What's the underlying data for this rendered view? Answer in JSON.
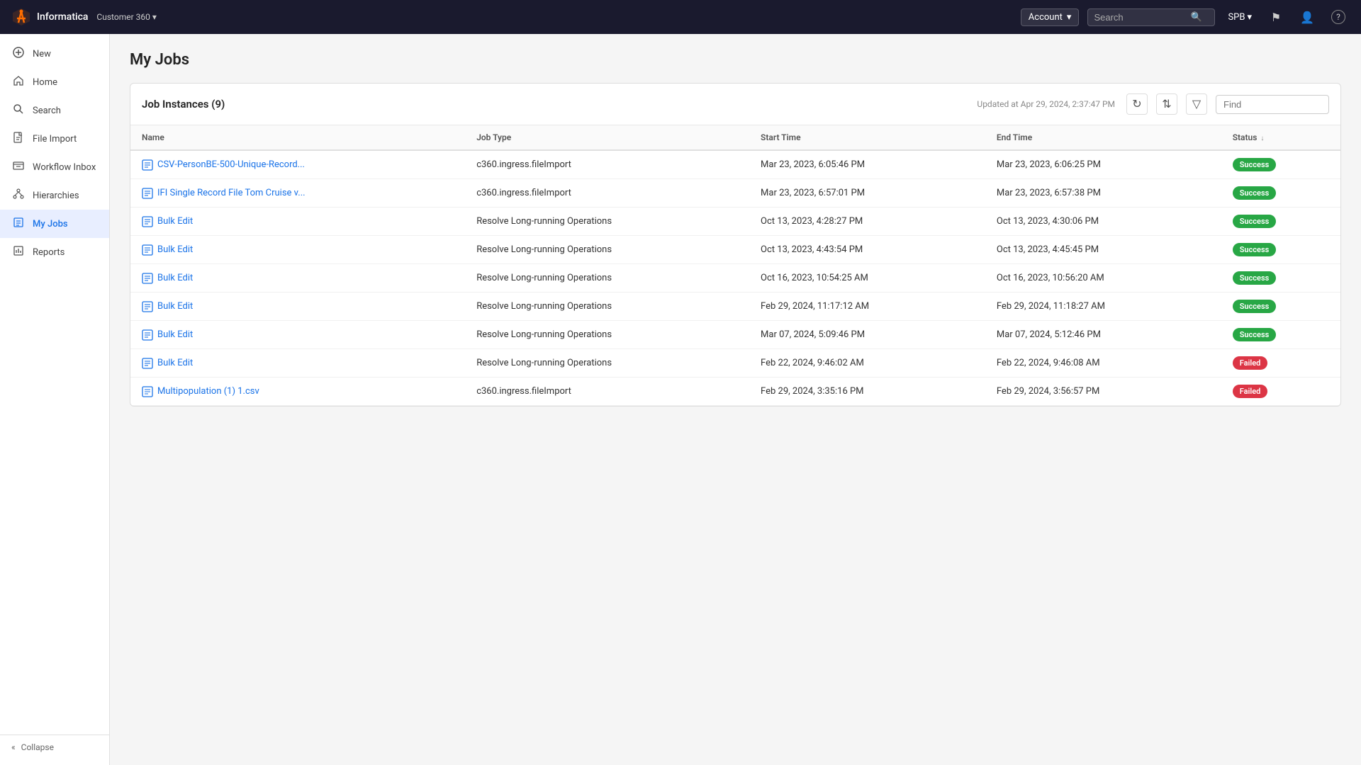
{
  "topNav": {
    "logoAlt": "Informatica",
    "appName": "Informatica",
    "customerLabel": "Customer 360",
    "accountLabel": "Account",
    "searchPlaceholder": "Search",
    "spbLabel": "SPB",
    "flagIconTitle": "flag",
    "userIconTitle": "user",
    "helpIconTitle": "help"
  },
  "sidebar": {
    "items": [
      {
        "id": "new",
        "label": "New",
        "icon": "+"
      },
      {
        "id": "home",
        "label": "Home",
        "icon": "⌂"
      },
      {
        "id": "search",
        "label": "Search",
        "icon": "🔍"
      },
      {
        "id": "file-import",
        "label": "File Import",
        "icon": "📄"
      },
      {
        "id": "workflow-inbox",
        "label": "Workflow Inbox",
        "icon": "📥"
      },
      {
        "id": "hierarchies",
        "label": "Hierarchies",
        "icon": "🔗"
      },
      {
        "id": "my-jobs",
        "label": "My Jobs",
        "icon": "📋",
        "active": true
      },
      {
        "id": "reports",
        "label": "Reports",
        "icon": "📊"
      }
    ],
    "collapseLabel": "Collapse"
  },
  "mainPage": {
    "title": "My Jobs",
    "panel": {
      "title": "Job Instances (9)",
      "updatedText": "Updated at Apr 29, 2024, 2:37:47 PM",
      "findPlaceholder": "Find",
      "columns": [
        {
          "id": "name",
          "label": "Name"
        },
        {
          "id": "job-type",
          "label": "Job Type"
        },
        {
          "id": "start-time",
          "label": "Start Time"
        },
        {
          "id": "end-time",
          "label": "End Time"
        },
        {
          "id": "status",
          "label": "Status",
          "sorted": true
        }
      ],
      "rows": [
        {
          "name": "CSV-PersonBE-500-Unique-Record...",
          "jobType": "c360.ingress.fileImport",
          "startTime": "Mar 23, 2023, 6:05:46 PM",
          "endTime": "Mar 23, 2023, 6:06:25 PM",
          "status": "Success",
          "statusClass": "status-success"
        },
        {
          "name": "IFI Single Record File Tom Cruise v...",
          "jobType": "c360.ingress.fileImport",
          "startTime": "Mar 23, 2023, 6:57:01 PM",
          "endTime": "Mar 23, 2023, 6:57:38 PM",
          "status": "Success",
          "statusClass": "status-success"
        },
        {
          "name": "Bulk Edit",
          "jobType": "Resolve Long-running Operations",
          "startTime": "Oct 13, 2023, 4:28:27 PM",
          "endTime": "Oct 13, 2023, 4:30:06 PM",
          "status": "Success",
          "statusClass": "status-success"
        },
        {
          "name": "Bulk Edit",
          "jobType": "Resolve Long-running Operations",
          "startTime": "Oct 13, 2023, 4:43:54 PM",
          "endTime": "Oct 13, 2023, 4:45:45 PM",
          "status": "Success",
          "statusClass": "status-success"
        },
        {
          "name": "Bulk Edit",
          "jobType": "Resolve Long-running Operations",
          "startTime": "Oct 16, 2023, 10:54:25 AM",
          "endTime": "Oct 16, 2023, 10:56:20 AM",
          "status": "Success",
          "statusClass": "status-success"
        },
        {
          "name": "Bulk Edit",
          "jobType": "Resolve Long-running Operations",
          "startTime": "Feb 29, 2024, 11:17:12 AM",
          "endTime": "Feb 29, 2024, 11:18:27 AM",
          "status": "Success",
          "statusClass": "status-success"
        },
        {
          "name": "Bulk Edit",
          "jobType": "Resolve Long-running Operations",
          "startTime": "Mar 07, 2024, 5:09:46 PM",
          "endTime": "Mar 07, 2024, 5:12:46 PM",
          "status": "Success",
          "statusClass": "status-success"
        },
        {
          "name": "Bulk Edit",
          "jobType": "Resolve Long-running Operations",
          "startTime": "Feb 22, 2024, 9:46:02 AM",
          "endTime": "Feb 22, 2024, 9:46:08 AM",
          "status": "Failed",
          "statusClass": "status-failed"
        },
        {
          "name": "Multipopulation (1) 1.csv",
          "jobType": "c360.ingress.fileImport",
          "startTime": "Feb 29, 2024, 3:35:16 PM",
          "endTime": "Feb 29, 2024, 3:56:57 PM",
          "status": "Failed",
          "statusClass": "status-failed"
        }
      ]
    }
  }
}
